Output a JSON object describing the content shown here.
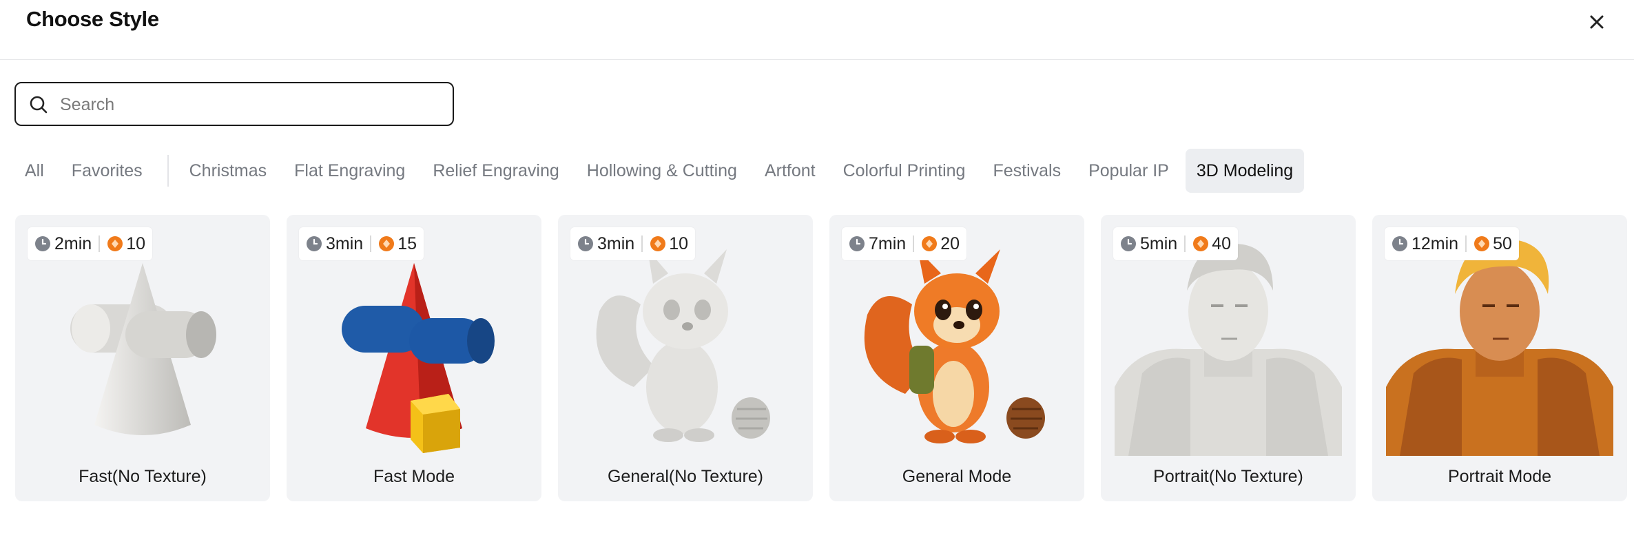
{
  "dialog": {
    "title": "Choose Style"
  },
  "search": {
    "placeholder": "Search",
    "value": ""
  },
  "tabs": [
    {
      "label": "All"
    },
    {
      "label": "Favorites"
    },
    {
      "label": "Christmas"
    },
    {
      "label": "Flat Engraving"
    },
    {
      "label": "Relief Engraving"
    },
    {
      "label": "Hollowing & Cutting"
    },
    {
      "label": "Artfont"
    },
    {
      "label": "Colorful Printing"
    },
    {
      "label": "Festivals"
    },
    {
      "label": "Popular IP"
    },
    {
      "label": "3D Modeling",
      "active": true
    }
  ],
  "cards": [
    {
      "label": "Fast(No Texture)",
      "time": "2min",
      "credits": "10",
      "image": "gray-cone-cylinder"
    },
    {
      "label": "Fast Mode",
      "time": "3min",
      "credits": "15",
      "image": "color-cone-cylinder-cube"
    },
    {
      "label": "General(No Texture)",
      "time": "3min",
      "credits": "10",
      "image": "gray-squirrel"
    },
    {
      "label": "General Mode",
      "time": "7min",
      "credits": "20",
      "image": "orange-squirrel"
    },
    {
      "label": "Portrait(No Texture)",
      "time": "5min",
      "credits": "40",
      "image": "gray-knight-portrait"
    },
    {
      "label": "Portrait Mode",
      "time": "12min",
      "credits": "50",
      "image": "golden-knight-portrait"
    }
  ],
  "colors": {
    "accent": "#f07a1a",
    "card_bg": "#f2f3f5",
    "active_tab_bg": "#eceef1"
  }
}
